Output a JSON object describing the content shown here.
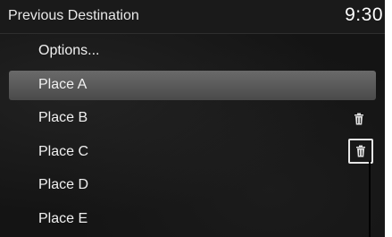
{
  "header": {
    "title": "Previous Destination",
    "clock": "9:30"
  },
  "list": {
    "items": [
      {
        "label": "Options..."
      },
      {
        "label": "Place A",
        "selected": true
      },
      {
        "label": "Place B",
        "icon": "trash-icon"
      },
      {
        "label": "Place C",
        "icon": "trash-icon"
      },
      {
        "label": "Place D"
      },
      {
        "label": "Place E"
      }
    ]
  }
}
